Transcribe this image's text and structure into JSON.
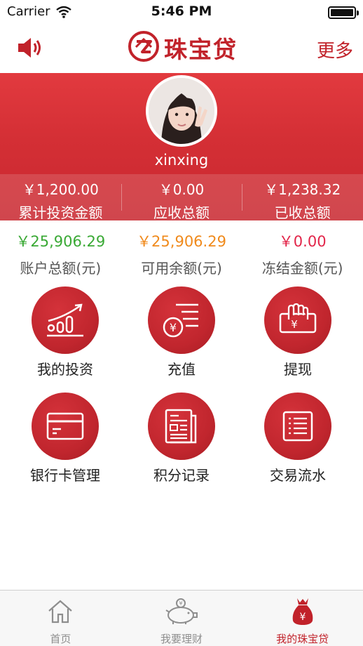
{
  "status_bar": {
    "carrier": "Carrier",
    "time": "5:46 PM"
  },
  "nav": {
    "title": "珠宝贷",
    "more_label": "更多",
    "icons": [
      "speaker-icon",
      "logo-icon"
    ]
  },
  "profile": {
    "username": "xinxing"
  },
  "stats": [
    {
      "value": "￥1,200.00",
      "label": "累计投资金额"
    },
    {
      "value": "￥0.00",
      "label": "应收总额"
    },
    {
      "value": "￥1,238.32",
      "label": "已收总额"
    }
  ],
  "balances": [
    {
      "value": "￥25,906.29",
      "label": "账户总额(元)",
      "color": "#3aa935"
    },
    {
      "value": "￥25,906.29",
      "label": "可用余额(元)",
      "color": "#f08a1c"
    },
    {
      "value": "￥0.00",
      "label": "冻结金额(元)",
      "color": "#e2264a"
    }
  ],
  "features": [
    {
      "label": "我的投资",
      "icon": "chart-icon"
    },
    {
      "label": "充值",
      "icon": "recharge-icon"
    },
    {
      "label": "提现",
      "icon": "withdraw-icon"
    },
    {
      "label": "银行卡管理",
      "icon": "bank-card-icon"
    },
    {
      "label": "积分记录",
      "icon": "points-record-icon"
    },
    {
      "label": "交易流水",
      "icon": "transaction-list-icon"
    }
  ],
  "tabs": [
    {
      "label": "首页",
      "icon": "home-icon",
      "active": false
    },
    {
      "label": "我要理财",
      "icon": "piggy-bank-icon",
      "active": false
    },
    {
      "label": "我的珠宝贷",
      "icon": "money-bag-icon",
      "active": true
    }
  ],
  "colors": {
    "brand": "#c1222a",
    "header": "#d42f35"
  }
}
